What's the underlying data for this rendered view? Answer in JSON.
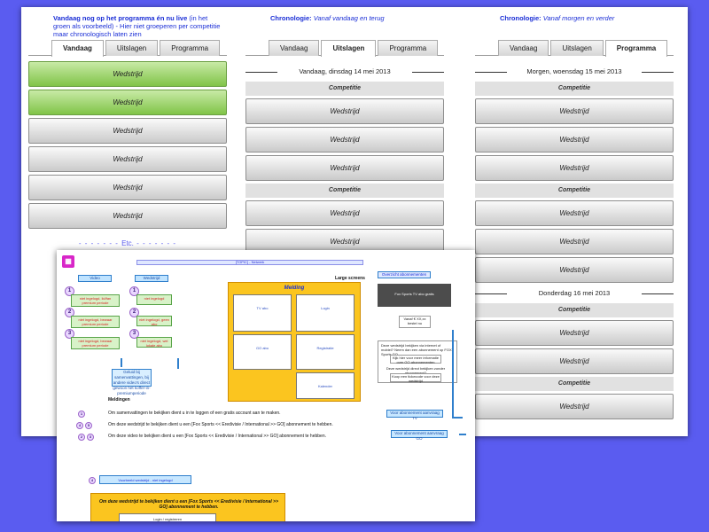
{
  "columns": [
    {
      "header_prefix": "Vandaag nog op het programma én nu live",
      "header_rest": " (in het groen als voorbeeld) - Hier niet groeperen per competitie maar chronologisch laten zien",
      "tabs": [
        "Vandaag",
        "Uitslagen",
        "Programma"
      ],
      "active_tab": 0,
      "rows": [
        {
          "kind": "match",
          "label": "Wedstrijd",
          "green": true
        },
        {
          "kind": "match",
          "label": "Wedstrijd",
          "green": true
        },
        {
          "kind": "match",
          "label": "Wedstrijd"
        },
        {
          "kind": "match",
          "label": "Wedstrijd"
        },
        {
          "kind": "match",
          "label": "Wedstrijd"
        },
        {
          "kind": "match",
          "label": "Wedstrijd"
        },
        {
          "kind": "etc",
          "label": "Etc."
        }
      ]
    },
    {
      "header_prefix": "Chronologie:",
      "header_rest": " Vanaf vandaag en terug",
      "tabs": [
        "Vandaag",
        "Uitslagen",
        "Programma"
      ],
      "active_tab": 1,
      "rows": [
        {
          "kind": "date",
          "label": "Vandaag, dinsdag 14 mei 2013"
        },
        {
          "kind": "competition",
          "label": "Competitie"
        },
        {
          "kind": "match",
          "label": "Wedstrijd"
        },
        {
          "kind": "match",
          "label": "Wedstrijd"
        },
        {
          "kind": "match",
          "label": "Wedstrijd"
        },
        {
          "kind": "competition",
          "label": "Competitie"
        },
        {
          "kind": "match",
          "label": "Wedstrijd"
        },
        {
          "kind": "match",
          "label": "Wedstrijd"
        },
        {
          "kind": "match",
          "label": "Wedstrijd"
        }
      ]
    },
    {
      "header_prefix": "Chronologie:",
      "header_rest": " Vanaf morgen en verder",
      "tabs": [
        "Vandaag",
        "Uitslagen",
        "Programma"
      ],
      "active_tab": 2,
      "rows": [
        {
          "kind": "date",
          "label": "Morgen, woensdag 15 mei 2013"
        },
        {
          "kind": "competition",
          "label": "Competitie"
        },
        {
          "kind": "match",
          "label": "Wedstrijd"
        },
        {
          "kind": "match",
          "label": "Wedstrijd"
        },
        {
          "kind": "match",
          "label": "Wedstrijd"
        },
        {
          "kind": "competition",
          "label": "Competitie"
        },
        {
          "kind": "match",
          "label": "Wedstrijd"
        },
        {
          "kind": "match",
          "label": "Wedstrijd"
        },
        {
          "kind": "match",
          "label": "Wedstrijd"
        },
        {
          "kind": "date",
          "label": "Donderdag 16 mei 2013"
        },
        {
          "kind": "competition",
          "label": "Competitie"
        },
        {
          "kind": "match",
          "label": "Wedstrijd"
        },
        {
          "kind": "match",
          "label": "Wedstrijd"
        },
        {
          "kind": "competition",
          "label": "Competitie"
        },
        {
          "kind": "match",
          "label": "Wedstrijd"
        }
      ]
    }
  ],
  "wireframe": {
    "title": "[TOPIC] - Netwerk",
    "video_label": "Video",
    "match_label": "Wedstrijd",
    "green_video": [
      "niet ingelogd, lid/fan premium periode",
      "niet ingelogd, bewaar premium periode",
      "niet ingelogd, bewaar premium periode"
    ],
    "green_match": [
      "niet ingelogd",
      "niet ingelogd, geen abo",
      "niet ingelogd, wel lokale abo"
    ],
    "note_box": "Geluid bij samenvattingen, bij andere video's direct gewoon het koffer-in-premiumperiode",
    "large_title": "Large screens",
    "melding": "Melding",
    "panels": [
      "TV abo",
      "Login",
      "GO abo",
      "Registratie",
      "Kalender"
    ],
    "meldingen_label": "Meldingen",
    "lines": [
      "Om samenvattingen te bekijken dient u in te loggen of een gratis account aan te maken.",
      "Om deze wedstrijd te bekijken dient u een [Fox Sports << Eredivisie / International >> GO] abonnement te hebben.",
      "Om deze video te bekijken dient u een [Fox Sports << Eredivisie / International >> GO] abonnement te hebben."
    ],
    "right_head": "Overzicht abonnementen",
    "right_sub": "Fox Sports TV abo gratis",
    "right_btn": "Vanaf € XX,xx bestel nu",
    "question_title": "Deze wedstrijd bekijken via internet of mobiel? Neem dan een abonnement op FOX Sports GO",
    "q_btn1": "Kijk hier voor meer informatie over GO abonnementen",
    "q_text": "Deze wedstrijd direct bekijken zonder abonnement?",
    "q_btn2": "Koop een tickecode voor deze wedstrijd",
    "sub1": "Voor abonnement aanvraag TV",
    "sub2": "Voor abonnement aanvraag GO",
    "footer_label": "Voorbeeld wedstrijd - niet ingelogd",
    "orange_text": "Om deze wedstrijd te bekijken dient u een [Fox Sports << Eredivisie / International >> GO] abonnement te hebben.",
    "login_label": "Login / registreren"
  }
}
